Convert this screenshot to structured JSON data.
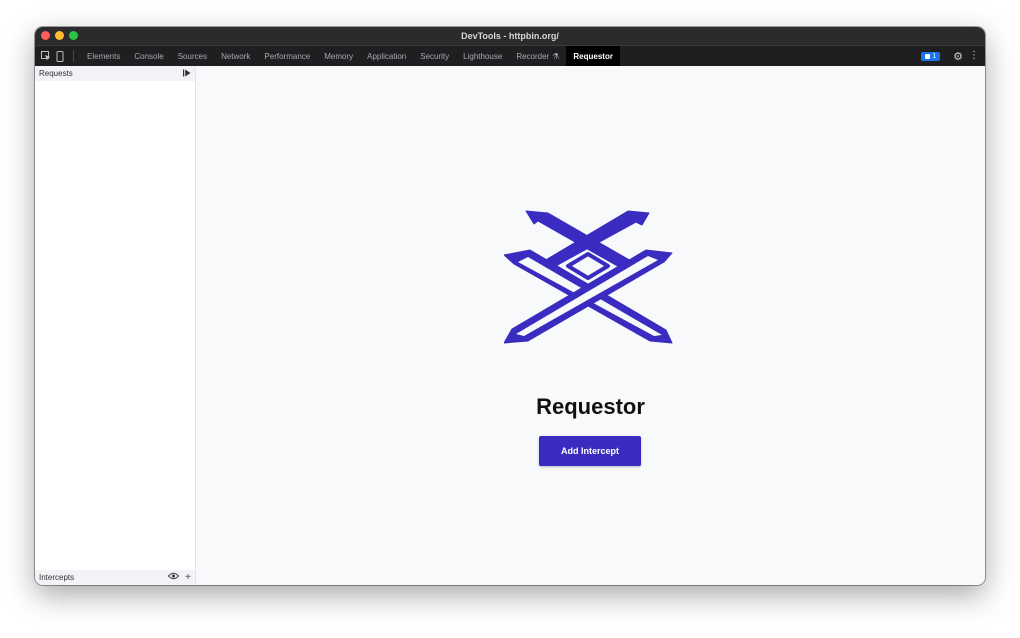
{
  "window": {
    "title": "DevTools - httpbin.org/"
  },
  "tabs": [
    {
      "label": "Elements"
    },
    {
      "label": "Console"
    },
    {
      "label": "Sources"
    },
    {
      "label": "Network"
    },
    {
      "label": "Performance"
    },
    {
      "label": "Memory"
    },
    {
      "label": "Application"
    },
    {
      "label": "Security"
    },
    {
      "label": "Lighthouse"
    },
    {
      "label": "Recorder"
    },
    {
      "label": "Requestor"
    }
  ],
  "toolbar": {
    "issues_count": "1"
  },
  "sidebar": {
    "requests_label": "Requests",
    "intercepts_label": "Intercepts"
  },
  "main": {
    "title": "Requestor",
    "add_button_label": "Add Intercept"
  },
  "colors": {
    "accent": "#3a2bc1",
    "active_tab_bg": "#000000",
    "titlebar": "#2b2b2e"
  },
  "icons": {
    "inspect": "inspect-element-icon",
    "device": "device-toolbar-icon",
    "flask": "flask-icon",
    "settings": "gear-icon",
    "more": "kebab-menu-icon",
    "run": "play-icon",
    "visibility": "eye-icon",
    "add": "plus-icon"
  }
}
